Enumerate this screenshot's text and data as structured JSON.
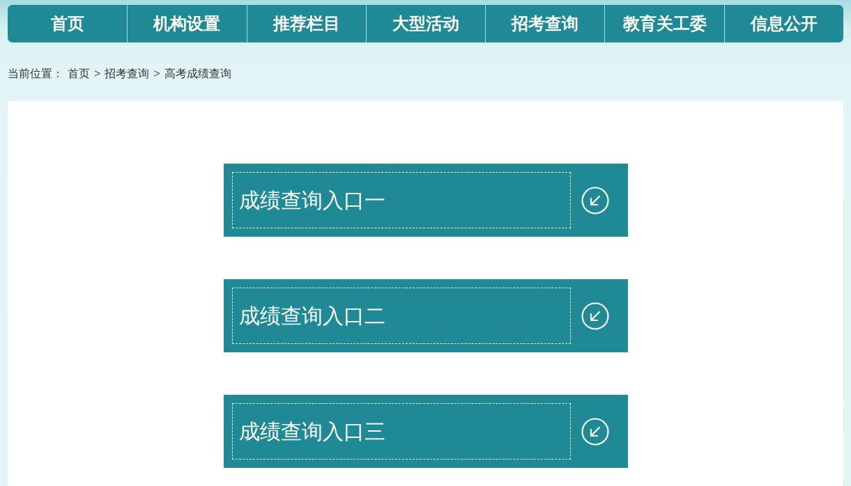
{
  "nav": {
    "items": [
      {
        "label": "首页"
      },
      {
        "label": "机构设置"
      },
      {
        "label": "推荐栏目"
      },
      {
        "label": "大型活动"
      },
      {
        "label": "招考查询"
      },
      {
        "label": "教育关工委"
      },
      {
        "label": "信息公开"
      }
    ]
  },
  "breadcrumb": {
    "label": "当前位置：",
    "items": [
      {
        "kind": "link",
        "text": "首页"
      },
      {
        "kind": "separator",
        "text": ">"
      },
      {
        "kind": "link",
        "text": "招考查询"
      },
      {
        "kind": "separator",
        "text": ">"
      },
      {
        "kind": "current",
        "text": "高考成绩查询"
      }
    ]
  },
  "entries": [
    {
      "label": "成绩查询入口一"
    },
    {
      "label": "成绩查询入口二"
    },
    {
      "label": "成绩查询入口三"
    }
  ]
}
